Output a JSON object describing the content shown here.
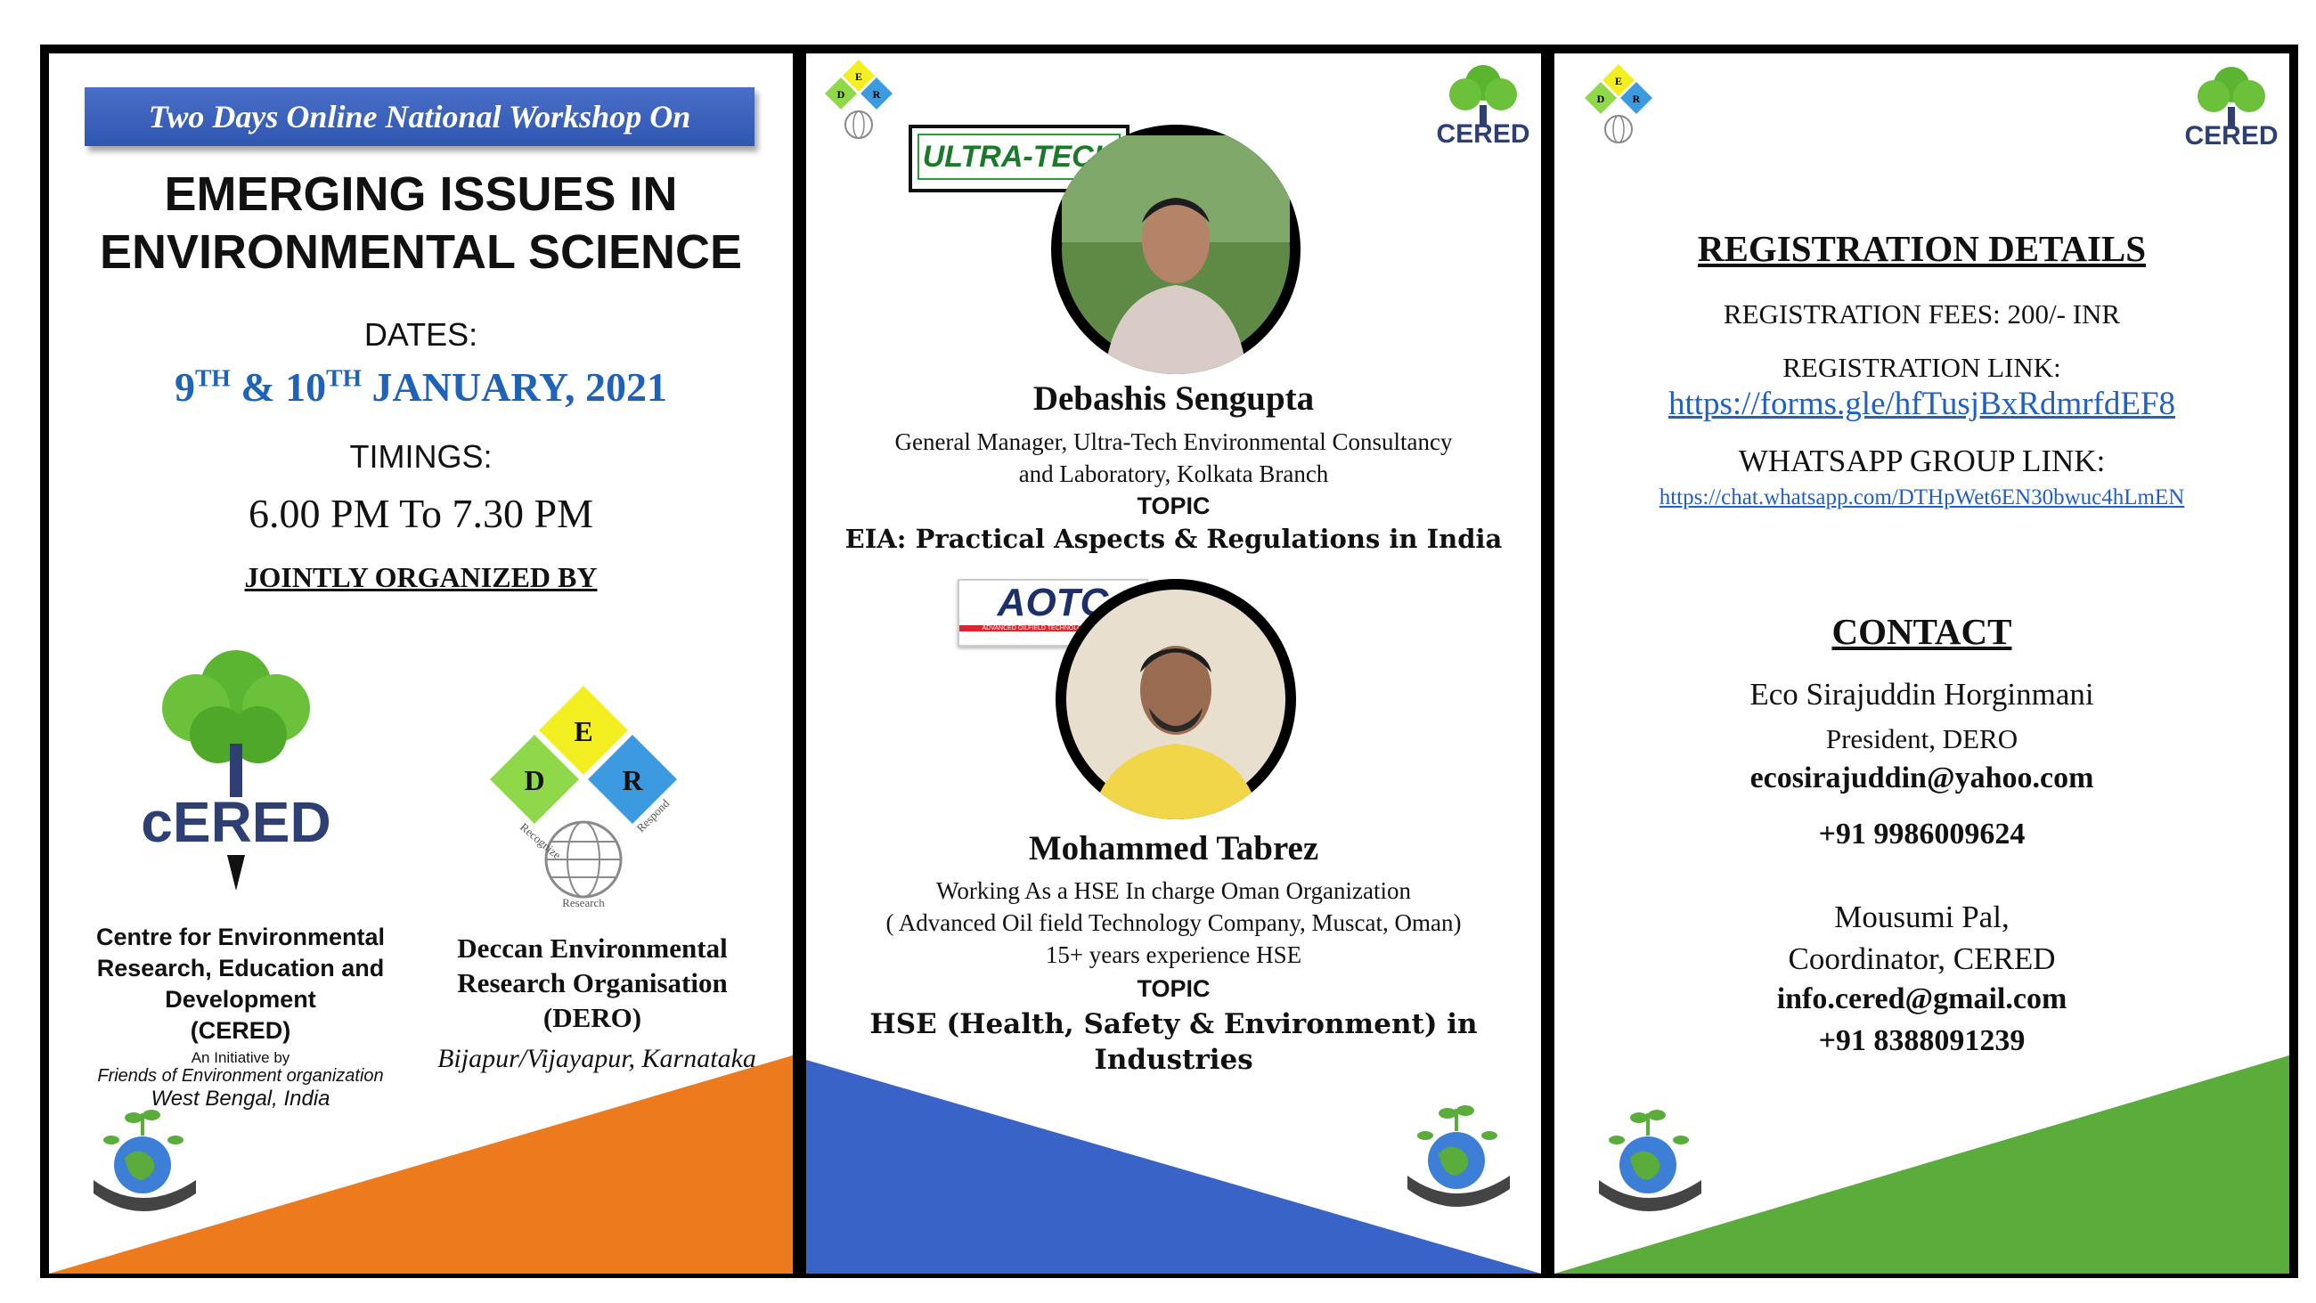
{
  "panel1": {
    "banner": "Two Days Online National Workshop On",
    "title_line1": "EMERGING ISSUES IN",
    "title_line2": "ENVIRONMENTAL SCIENCE",
    "dates_label": "DATES:",
    "date_d1": "9",
    "date_sup1": "TH",
    "date_amp": " & 10",
    "date_sup2": "TH",
    "date_rest": " JANUARY, 2021",
    "timings_label": "TIMINGS:",
    "timings": "6.00 PM To 7.30 PM",
    "jointly": "JOINTLY ORGANIZED BY",
    "cered_logo_text": "cERED",
    "cered_name_l1": "Centre for Environmental",
    "cered_name_l2": "Research, Education and",
    "cered_name_l3": "Development",
    "cered_name_l4": "(CERED)",
    "initiative": "An Initiative by",
    "initiative_org": "Friends of Environment organization",
    "initiative_loc": "West Bengal, India",
    "dero_e": "E",
    "dero_d": "D",
    "dero_r": "R",
    "dero_recognize": "Recognize",
    "dero_respond": "Respond",
    "dero_research": "Research",
    "dero_name_l1": "Deccan Environmental",
    "dero_name_l2": "Research Organisation",
    "dero_name_l3": "(DERO)",
    "dero_loc": "Bijapur/Vijayapur, Karnataka"
  },
  "panel2": {
    "cered_logo_text": "CERED",
    "ultratech_logo": "ULTRA-TECH",
    "speaker1_name": "Debashis Sengupta",
    "speaker1_role_l1": "General Manager, Ultra-Tech Environmental Consultancy",
    "speaker1_role_l2": "and Laboratory, Kolkata Branch",
    "topic_label": "TOPIC",
    "speaker1_topic": "EIA: Practical Aspects & Regulations in India",
    "aotc_logo": "AOTC",
    "aotc_sub": "ADVANCED OILFIELD TECHNOLOGY COMPANY",
    "speaker2_name": "Mohammed Tabrez",
    "speaker2_role_l1": "Working As a HSE In charge Oman Organization",
    "speaker2_role_l2": "( Advanced Oil field Technology Company, Muscat, Oman)",
    "speaker2_role_l3": "15+ years experience HSE",
    "speaker2_topic_l1": "HSE (Health, Safety & Environment) in",
    "speaker2_topic_l2": "Industries"
  },
  "panel3": {
    "cered_logo_text": "CERED",
    "reg_heading": "REGISTRATION DETAILS",
    "reg_fees": "REGISTRATION FEES: 200/- INR",
    "reg_link_label": "REGISTRATION LINK:",
    "reg_link": "https://forms.gle/hfTusjBxRdmrfdEF8",
    "wa_label": "WHATSAPP GROUP LINK:",
    "wa_link": "https://chat.whatsapp.com/DTHpWet6EN30bwuc4hLmEN",
    "contact_heading": "CONTACT",
    "c1_name": "Eco Sirajuddin Horginmani",
    "c1_role": "President, DERO",
    "c1_email": "ecosirajuddin@yahoo.com",
    "c1_phone": "+91 9986009624",
    "c2_name": "Mousumi Pal,",
    "c2_role": "Coordinator, CERED",
    "c2_email": "info.cered@gmail.com",
    "c2_phone": "+91 8388091239"
  },
  "colors": {
    "banner_blue": "#2f56b0",
    "date_blue": "#1f63b8",
    "orange": "#ee7a1e",
    "royal_blue": "#3a63c8",
    "green": "#5aad3a",
    "cered_navy": "#2d3f73",
    "dero_yellow": "#f4ef21",
    "dero_green": "#8ed84a",
    "dero_blue": "#3c9be0"
  },
  "icons": [
    "earth-in-hand-icon",
    "globe-icon",
    "tree-icon",
    "pen-nib-icon"
  ]
}
